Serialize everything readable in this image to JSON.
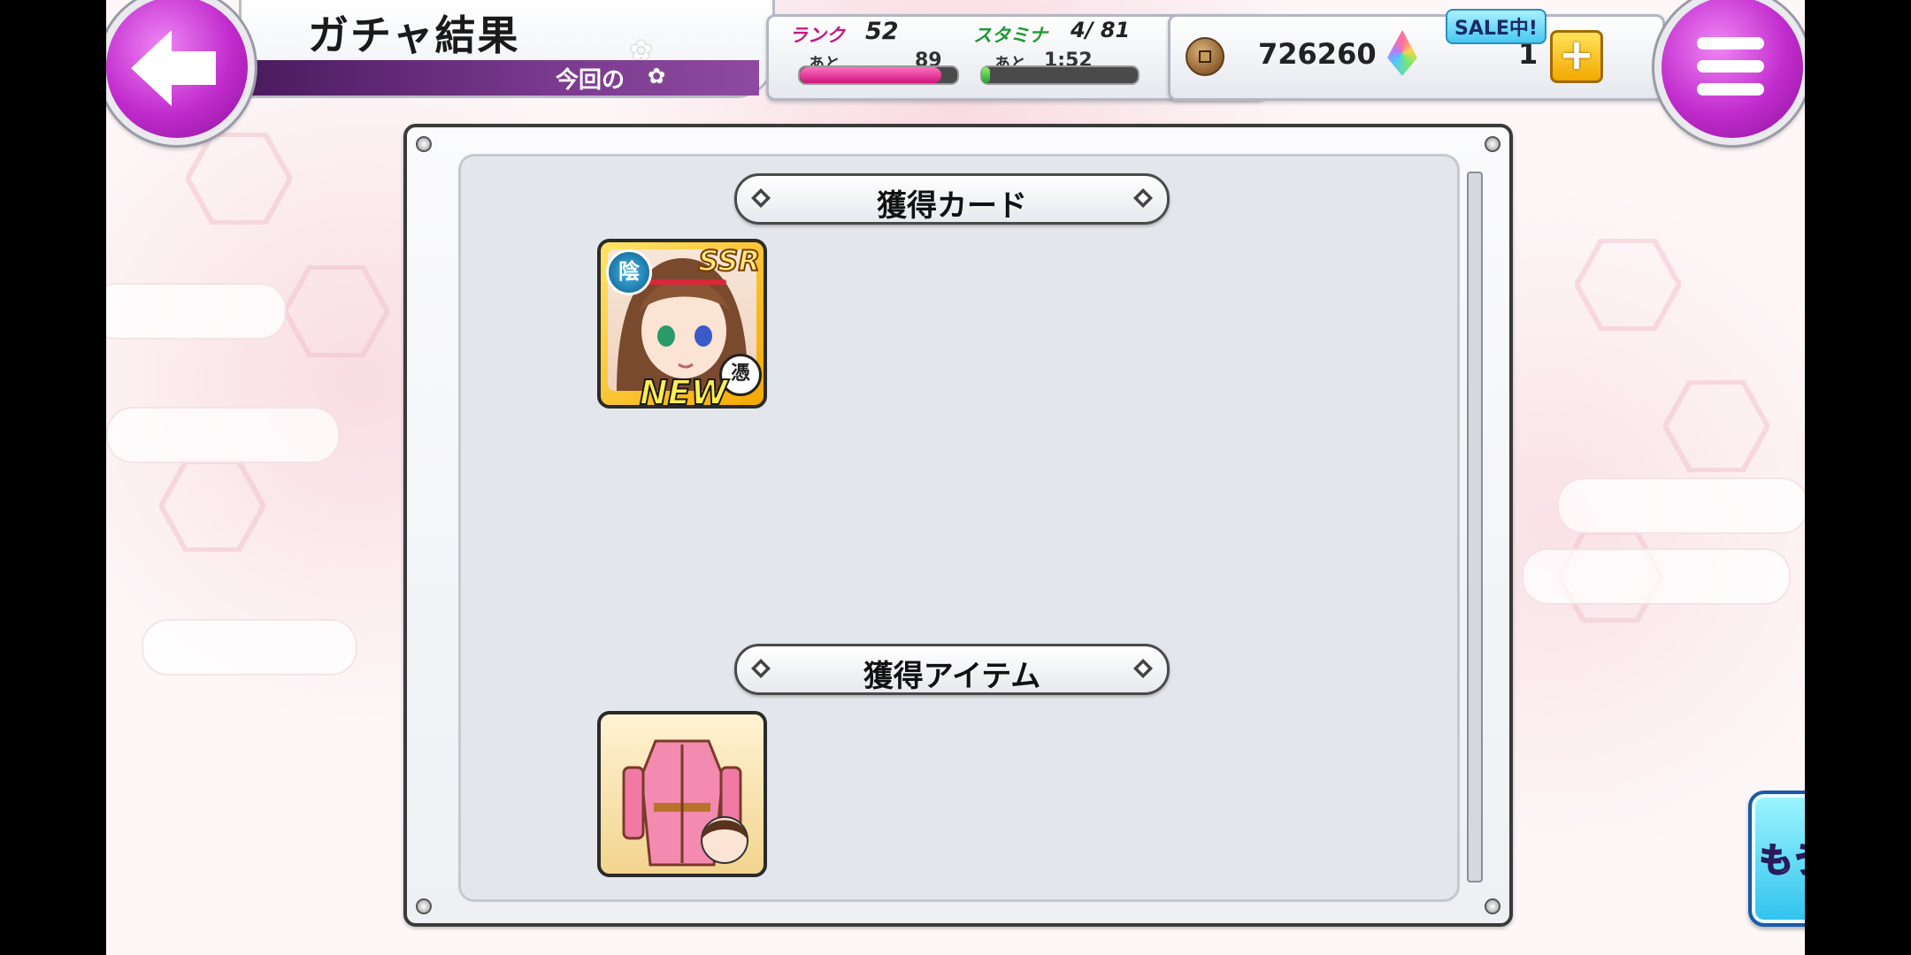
{
  "header": {
    "title": "ガチャ結果",
    "subtitle": "今回の"
  },
  "status": {
    "rank_label": "ランク",
    "rank_value": "52",
    "rank_remaining_label": "あと",
    "rank_remaining_value": "89",
    "rank_progress": 0.9,
    "stamina_label": "スタミナ",
    "stamina_value": "4/ 81",
    "stamina_timer_label": "あと",
    "stamina_timer_value": "1:52",
    "stamina_progress": 0.05,
    "coins": "726260",
    "gems": "1",
    "sale_badge": "SALE中!"
  },
  "sections": {
    "cards_label": "獲得カード",
    "items_label": "獲得アイテム"
  },
  "card": {
    "rarity": "SSR",
    "attribute": "陰",
    "type": "憑",
    "new_label": "NEW"
  },
  "actions": {
    "draw_again_label": "もう一度引く"
  },
  "icons": {
    "back": "left-arrow-icon",
    "menu": "hamburger-menu-icon",
    "coin": "coin-icon",
    "gem": "rainbow-gem-icon",
    "add": "plus-icon"
  },
  "colors": {
    "accent_purple": "#c12bcd",
    "rank_bar": "#e0248e",
    "stamina_bar": "#3ab54a",
    "draw_button": "#2fc2ee"
  }
}
